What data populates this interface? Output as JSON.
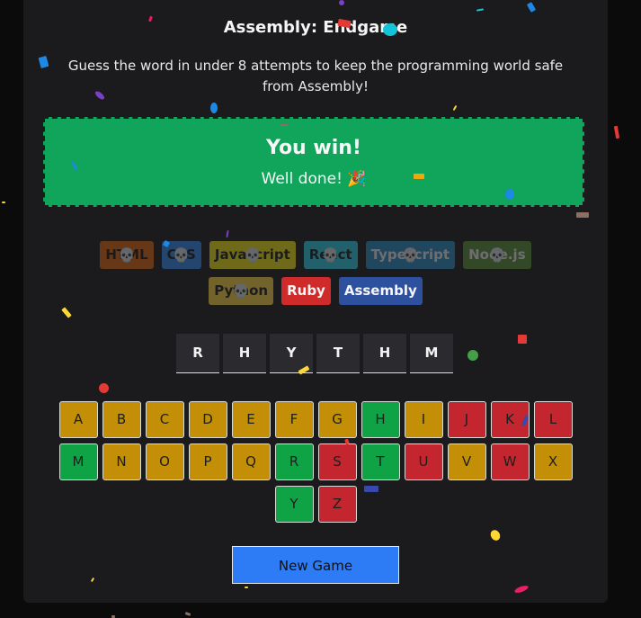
{
  "title": "Assembly: Endgame",
  "subtitle": "Guess the word in under 8 attempts to keep the programming world safe from Assembly!",
  "status": {
    "heading": "You win!",
    "message": "Well done! 🎉"
  },
  "languages": [
    {
      "name": "HTML",
      "bg": "#e2680f",
      "fg": "#1a1a1a",
      "lost": true
    },
    {
      "name": "CSS",
      "bg": "#328af1",
      "fg": "#1a1a1a",
      "lost": true
    },
    {
      "name": "Javascript",
      "bg": "#f4eb13",
      "fg": "#1e1e1e",
      "lost": true
    },
    {
      "name": "React",
      "bg": "#2ed3e9",
      "fg": "#1e1e1e",
      "lost": true
    },
    {
      "name": "Typescript",
      "bg": "#298ec6",
      "fg": "#f5f5f5",
      "lost": true
    },
    {
      "name": "Node.js",
      "bg": "#599137",
      "fg": "#f5f5f5",
      "lost": true
    },
    {
      "name": "Python",
      "bg": "#ffd742",
      "fg": "#1e1e1e",
      "lost": true
    },
    {
      "name": "Ruby",
      "bg": "#d02b2b",
      "fg": "#f5f5f5",
      "lost": false
    },
    {
      "name": "Assembly",
      "bg": "#2d519f",
      "fg": "#f5f5f5",
      "lost": false
    }
  ],
  "skull_icon": "skull-icon",
  "word": [
    "R",
    "H",
    "Y",
    "T",
    "H",
    "M"
  ],
  "keyboard": [
    {
      "letter": "A",
      "state": "unused"
    },
    {
      "letter": "B",
      "state": "unused"
    },
    {
      "letter": "C",
      "state": "unused"
    },
    {
      "letter": "D",
      "state": "unused"
    },
    {
      "letter": "E",
      "state": "unused"
    },
    {
      "letter": "F",
      "state": "unused"
    },
    {
      "letter": "G",
      "state": "unused"
    },
    {
      "letter": "H",
      "state": "correct"
    },
    {
      "letter": "I",
      "state": "unused"
    },
    {
      "letter": "J",
      "state": "wrong"
    },
    {
      "letter": "K",
      "state": "wrong"
    },
    {
      "letter": "L",
      "state": "wrong"
    },
    {
      "letter": "M",
      "state": "correct"
    },
    {
      "letter": "N",
      "state": "unused"
    },
    {
      "letter": "O",
      "state": "unused"
    },
    {
      "letter": "P",
      "state": "unused"
    },
    {
      "letter": "Q",
      "state": "unused"
    },
    {
      "letter": "R",
      "state": "correct"
    },
    {
      "letter": "S",
      "state": "wrong"
    },
    {
      "letter": "T",
      "state": "correct"
    },
    {
      "letter": "U",
      "state": "wrong"
    },
    {
      "letter": "V",
      "state": "unused"
    },
    {
      "letter": "W",
      "state": "wrong"
    },
    {
      "letter": "X",
      "state": "unused"
    },
    {
      "letter": "Y",
      "state": "correct"
    },
    {
      "letter": "Z",
      "state": "wrong"
    }
  ],
  "new_game_label": "New Game",
  "colors": {
    "correct": "#10a346",
    "wrong": "#c3262e",
    "unused": "#c28f06",
    "win_banner": "#10a55b",
    "new_game": "#2d7cf6"
  }
}
